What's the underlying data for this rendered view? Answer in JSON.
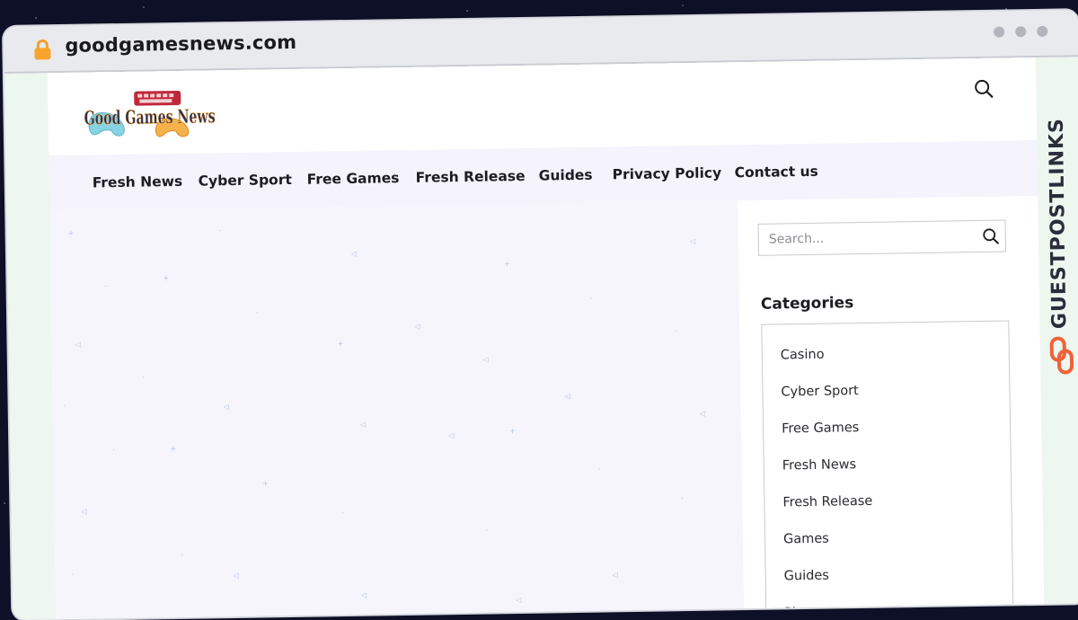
{
  "browser": {
    "url": "goodgamesnews.com"
  },
  "logo": {
    "text": "Good Games News"
  },
  "nav": {
    "items": [
      {
        "label": "Fresh News"
      },
      {
        "label": "Cyber Sport"
      },
      {
        "label": "Free Games"
      },
      {
        "label": "Fresh Release"
      },
      {
        "label": "Guides"
      },
      {
        "label": "Privacy Policy"
      },
      {
        "label": "Contact us"
      }
    ]
  },
  "sidebar": {
    "search": {
      "placeholder": "Search..."
    },
    "categories": {
      "title": "Categories",
      "items": [
        {
          "label": "Casino"
        },
        {
          "label": "Cyber Sport"
        },
        {
          "label": "Free Games"
        },
        {
          "label": "Fresh News"
        },
        {
          "label": "Fresh Release"
        },
        {
          "label": "Games"
        },
        {
          "label": "Guides"
        },
        {
          "label": "Phone"
        }
      ]
    }
  },
  "watermark": {
    "text": "GUESTPOSTLINKS"
  },
  "colors": {
    "nav_bg": "#f5f3fc",
    "content_bg": "#f6f5fc",
    "brand_orange": "#f0623a"
  }
}
